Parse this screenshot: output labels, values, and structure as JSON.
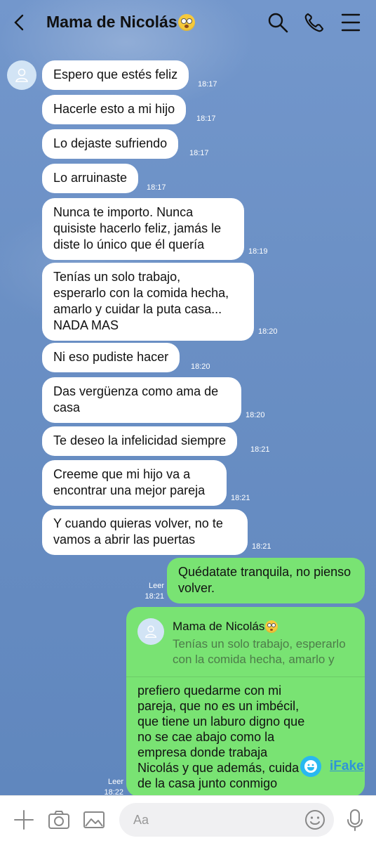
{
  "header": {
    "title": "Mama de Nicolás",
    "icons": [
      "back-arrow-icon",
      "emoji-rolling-eyes-icon",
      "search-icon",
      "phone-icon",
      "menu-icon"
    ]
  },
  "messages": [
    {
      "text": "Espero que estés feliz",
      "time": "18:17"
    },
    {
      "text": "Hacerle esto a mi hijo",
      "time": "18:17"
    },
    {
      "text": "Lo dejaste sufriendo",
      "time": "18:17"
    },
    {
      "text": "Lo arruinaste",
      "time": "18:17"
    },
    {
      "text": "Nunca te importo. Nunca\nquisiste hacerlo feliz, jamás le\ndiste lo único que él quería",
      "time": "18:19"
    },
    {
      "text": "Tenías un solo trabajo,\nesperarlo con la comida hecha,\namarlo y cuidar la puta casa...\nNADA MAS",
      "time": "18:20"
    },
    {
      "text": "Ni eso pudiste hacer",
      "time": "18:20"
    },
    {
      "text": "Das vergüenza como ama de\ncasa",
      "time": "18:20"
    },
    {
      "text": "Te deseo la infelicidad siempre",
      "time": "18:21"
    },
    {
      "text": "Creeme que mi hijo va a\nencontrar una mejor pareja",
      "time": "18:21"
    },
    {
      "text": "Y cuando quieras volver, no te\nvamos a abrir las puertas",
      "time": "18:21"
    }
  ],
  "my_messages": [
    {
      "text": "Quédatate tranquila, no pienso\nvolver.",
      "read": "Leer",
      "time": "18:21"
    }
  ],
  "reply": {
    "quote_name": "Mama de Nicolás",
    "quote_text": "Tenías un solo trabajo, esperarlo con la comida hecha, amarlo y",
    "text": "prefiero quedarme con mi\npareja, que no es un imbécil,\nque tiene un laburo digno que\nno se cae abajo como la\nempresa donde trabaja\nNicolás y que además, cuida\nde la casa junto conmigo",
    "read": "Leer",
    "time": "18:22"
  },
  "watermark": {
    "label": "iFake"
  },
  "input": {
    "placeholder": "Aa",
    "icons": [
      "plus-icon",
      "camera-icon",
      "image-icon",
      "emoji-icon",
      "microphone-icon"
    ]
  },
  "colors": {
    "background": "#6a8fc4",
    "incoming": "#ffffff",
    "outgoing": "#79e373"
  }
}
